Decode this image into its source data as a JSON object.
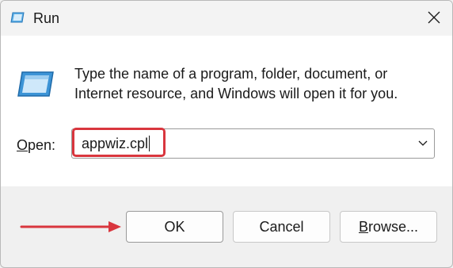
{
  "window": {
    "title": "Run",
    "close_icon": "close-icon"
  },
  "content": {
    "description_line1": "Type the name of a program, folder, document, or",
    "description_line2": "Internet resource, and Windows will open it for you.",
    "open_label_rest": "pen:",
    "open_label_accel": "O",
    "open_value": "appwiz.cpl"
  },
  "buttons": {
    "ok": "OK",
    "cancel": "Cancel",
    "browse_accel": "B",
    "browse_rest": "rowse..."
  },
  "annotation_color": "#d9363e"
}
